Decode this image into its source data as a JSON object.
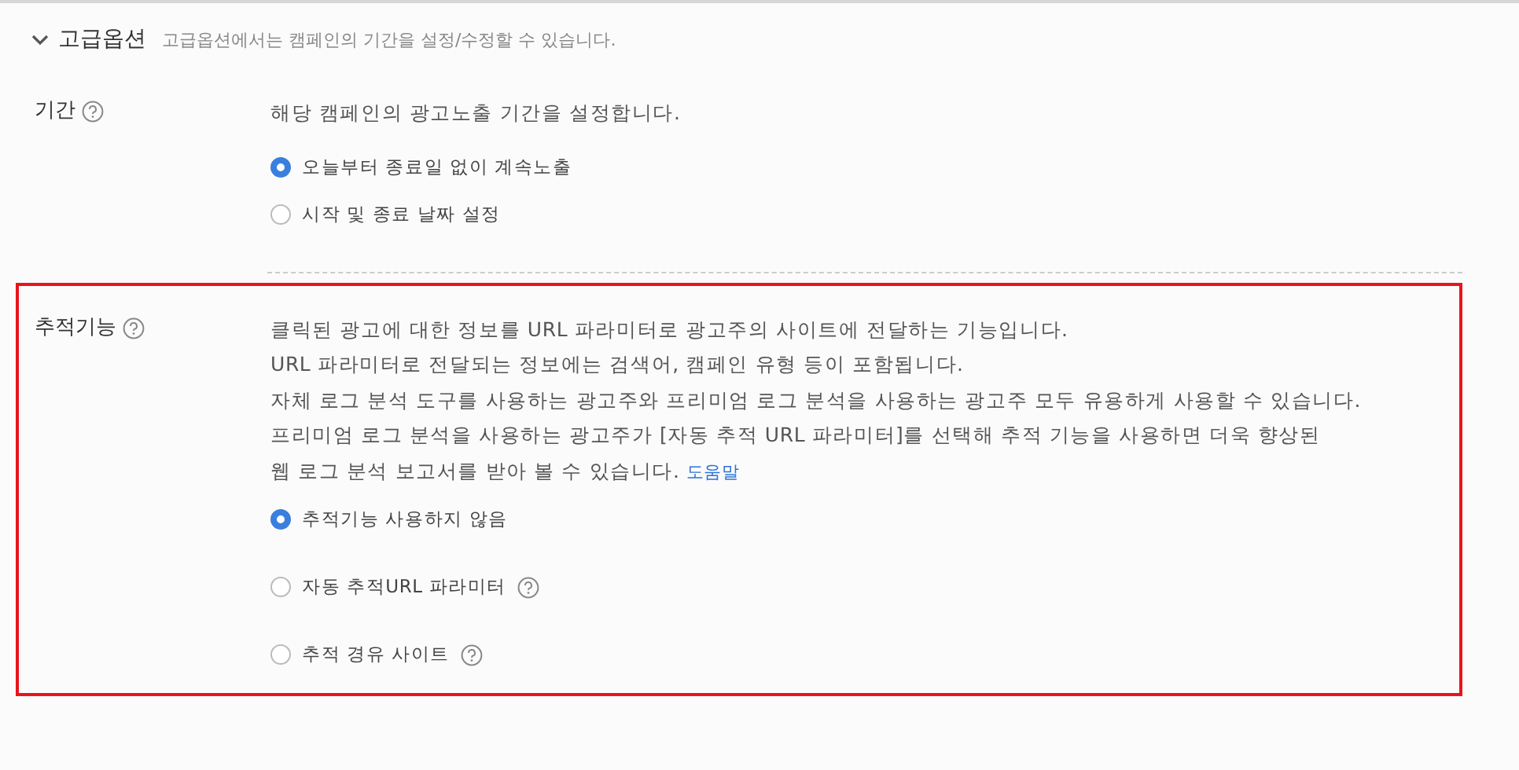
{
  "section": {
    "title": "고급옵션",
    "expanded": true,
    "description": "고급옵션에서는 캠페인의 기간을 설정/수정할 수 있습니다."
  },
  "fields": [
    {
      "label": "기간",
      "help": true,
      "highlighted": false,
      "lines": [
        "해당 캠페인의 광고노출 기간을 설정합니다."
      ],
      "options": [
        {
          "label": "오늘부터 종료일 없이 계속노출",
          "selected": true,
          "help": false
        },
        {
          "label": "시작 및 종료 날짜 설정",
          "selected": false,
          "help": false
        }
      ]
    },
    {
      "label": "추적기능",
      "help": true,
      "highlighted": true,
      "lines": [
        "클릭된 광고에 대한 정보를 URL 파라미터로 광고주의 사이트에 전달하는 기능입니다.",
        "URL 파라미터로 전달되는 정보에는 검색어, 캠페인 유형 등이 포함됩니다.",
        "자체 로그 분석 도구를 사용하는 광고주와 프리미엄 로그 분석을 사용하는 광고주 모두 유용하게 사용할 수 있습니다.",
        "프리미엄 로그 분석을 사용하는 광고주가 [자동 추적 URL 파라미터]를 선택해 추적 기능을 사용하면 더욱 향상된",
        "웹 로그 분석 보고서를 받아 볼 수 있습니다."
      ],
      "link": "도움말",
      "options": [
        {
          "label": "추적기능 사용하지 않음",
          "selected": true,
          "help": false
        },
        {
          "label": "자동 추적URL 파라미터",
          "selected": false,
          "help": true
        },
        {
          "label": "추적 경유 사이트",
          "selected": false,
          "help": true
        }
      ]
    }
  ]
}
